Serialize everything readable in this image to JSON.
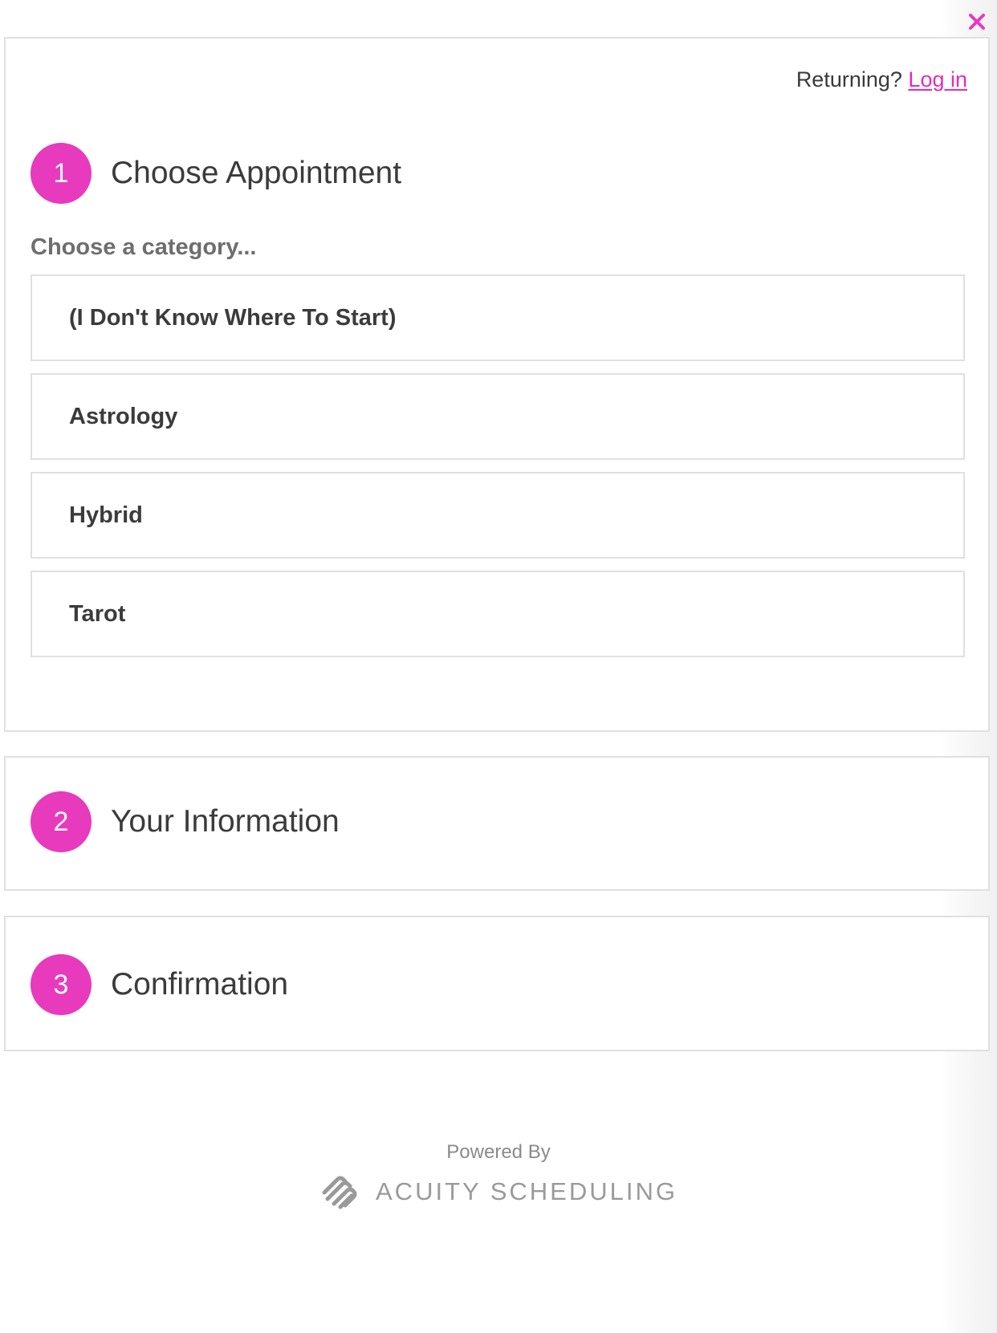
{
  "colors": {
    "accent": "#e83abc",
    "link": "#e52cb6",
    "border": "#e0e0e0",
    "text": "#3b3b3b",
    "muted": "#6e6e6e"
  },
  "close": {
    "icon": "close-icon"
  },
  "account": {
    "prompt": "Returning?",
    "login_label": "Log in"
  },
  "steps": [
    {
      "number": "1",
      "title": "Choose Appointment"
    },
    {
      "number": "2",
      "title": "Your Information"
    },
    {
      "number": "3",
      "title": "Confirmation"
    }
  ],
  "category": {
    "prompt": "Choose a category...",
    "items": [
      {
        "label": "(I Don't Know Where To Start)"
      },
      {
        "label": "Astrology"
      },
      {
        "label": "Hybrid"
      },
      {
        "label": "Tarot"
      }
    ]
  },
  "footer": {
    "powered_by": "Powered By",
    "brand_name": "ACUITY SCHEDULING",
    "brand_icon": "acuity-logo-icon"
  }
}
